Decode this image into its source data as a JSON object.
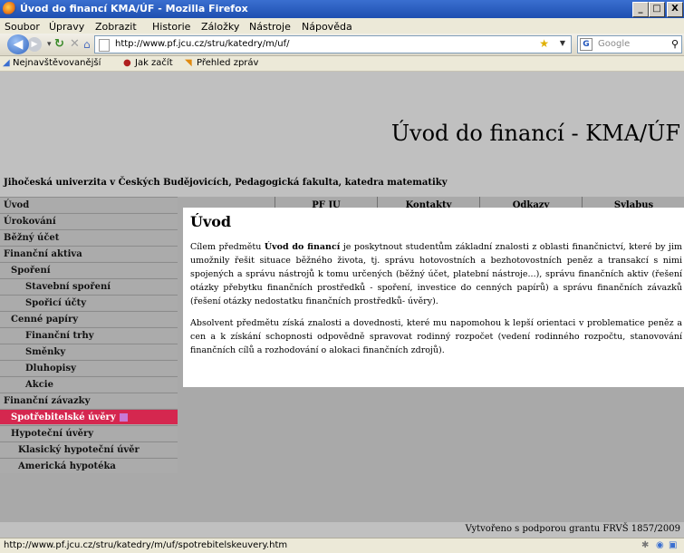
{
  "window": {
    "title": "Úvod do financí KMA/ÚF - Mozilla Firefox",
    "minimize": "_",
    "maximize": "□",
    "close": "X"
  },
  "menu": [
    "Soubor",
    "Úpravy",
    "Zobrazit",
    "Historie",
    "Záložky",
    "Nástroje",
    "Nápověda"
  ],
  "toolbar": {
    "url": "http://www.pf.jcu.cz/stru/katedry/m/uf/",
    "search_placeholder": "Google"
  },
  "bookmarks": [
    "Nejnavštěvovanější",
    "Jak začít",
    "Přehled zpráv"
  ],
  "site": {
    "title": "Úvod do financí - KMA/ÚF",
    "subtitle": "Jihočeská univerzita v Českých Budějovicích,   Pedagogická fakulta,   katedra matematiky",
    "topnav": [
      "PF JU",
      "Kontakty",
      "Odkazy",
      "Sylabus"
    ]
  },
  "sidebar": [
    {
      "label": "Úvod",
      "level": 0
    },
    {
      "label": "Úrokování",
      "level": 0
    },
    {
      "label": "Běžný účet",
      "level": 0
    },
    {
      "label": "Finanční aktiva",
      "level": 0
    },
    {
      "label": "Spoření",
      "level": 1
    },
    {
      "label": "Stavební spoření",
      "level": 2
    },
    {
      "label": "Spořicí účty",
      "level": 2
    },
    {
      "label": "Cenné papíry",
      "level": 1
    },
    {
      "label": "Finanční trhy",
      "level": 2
    },
    {
      "label": "Směnky",
      "level": 2
    },
    {
      "label": "Dluhopisy",
      "level": 2
    },
    {
      "label": "Akcie",
      "level": 2
    },
    {
      "label": "Finanční závazky",
      "level": 0
    },
    {
      "label": "Spotřebitelské úvěry",
      "level": 0,
      "active": true
    },
    {
      "label": "Hypoteční úvěry",
      "level": 0
    },
    {
      "label": "Klasický hypoteční úvěr",
      "level": 1
    },
    {
      "label": "Americká hypotéka",
      "level": 1
    }
  ],
  "content": {
    "heading": "Úvod",
    "p1_a": "Cílem předmětu ",
    "p1_b": "Úvod do financí",
    "p1_c": " je poskytnout studentům základní znalosti z oblasti finančnictví, které by jim umožnily řešit situace běžného života, tj. správu hotovostních a bezhotovostních peněz a transakcí s nimi spojených a správu nástrojů k tomu určených (běžný účet, platební nástroje...), správu finančních aktiv (řešení otázky přebytku finančních prostředků - spoření, investice do cenných papírů) a správu finančních závazků (řešení otázky nedostatku finančních prostředků- úvěry).",
    "p2": "Absolvent předmětu získá znalosti a dovednosti, které mu napomohou k lepší orientaci v problematice peněz a cen a k získání schopnosti odpovědně spravovat rodinný rozpočet (vedení rodinného rozpočtu, stanovování finančních cílů a rozhodování o alokaci finančních zdrojů)."
  },
  "footer": "Vytvořeno s podporou grantu FRVŠ 1857/2009",
  "status": "http://www.pf.jcu.cz/stru/katedry/m/uf/spotrebitelskeuvery.htm",
  "colors": {
    "active_item": "#d5274f",
    "titlebar": "#2a5cc0"
  }
}
